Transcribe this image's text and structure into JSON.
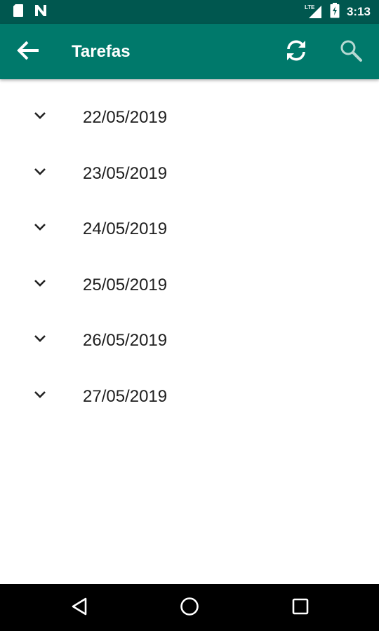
{
  "status_bar": {
    "network_label": "LTE",
    "time": "3:13",
    "icons": [
      "sd-card-icon",
      "n-notification-icon",
      "lte-signal-icon",
      "battery-charging-icon"
    ]
  },
  "app_bar": {
    "title": "Tarefas",
    "back_icon": "arrow-back-icon",
    "actions": [
      "refresh-icon",
      "search-icon"
    ],
    "color": "#00796b",
    "status_color": "#00574f"
  },
  "task_dates": [
    {
      "label": "22/05/2019",
      "icon": "chevron-down-icon"
    },
    {
      "label": "23/05/2019",
      "icon": "chevron-down-icon"
    },
    {
      "label": "24/05/2019",
      "icon": "chevron-down-icon"
    },
    {
      "label": "25/05/2019",
      "icon": "chevron-down-icon"
    },
    {
      "label": "26/05/2019",
      "icon": "chevron-down-icon"
    },
    {
      "label": "27/05/2019",
      "icon": "chevron-down-icon"
    }
  ],
  "nav_bar": {
    "buttons": [
      "back-triangle-icon",
      "home-circle-icon",
      "recents-square-icon"
    ]
  }
}
